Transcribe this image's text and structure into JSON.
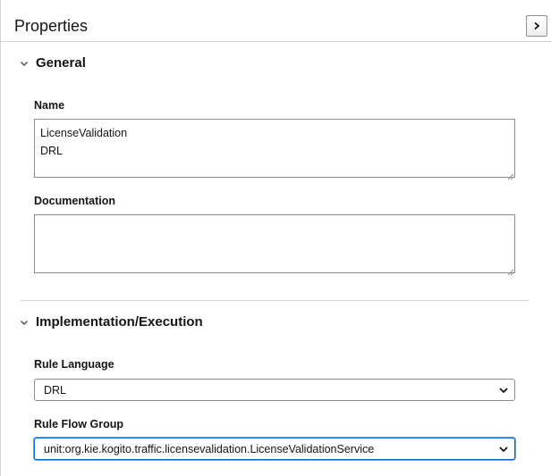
{
  "panel": {
    "title": "Properties",
    "collapse_icon": "chevron-right-icon"
  },
  "sections": {
    "general": {
      "title": "General",
      "expanded": true,
      "name_label": "Name",
      "name_value": "LicenseValidation\nDRL",
      "documentation_label": "Documentation",
      "documentation_value": ""
    },
    "implementation": {
      "title": "Implementation/Execution",
      "expanded": true,
      "rule_language_label": "Rule Language",
      "rule_language_value": "DRL",
      "rule_flow_group_label": "Rule Flow Group",
      "rule_flow_group_value": "unit:org.kie.kogito.traffic.licensevalidation.LicenseValidationService"
    }
  },
  "colors": {
    "border": "#8a8d90",
    "divider": "#d2d2d2",
    "focus": "#0066cc",
    "text": "#151515"
  }
}
